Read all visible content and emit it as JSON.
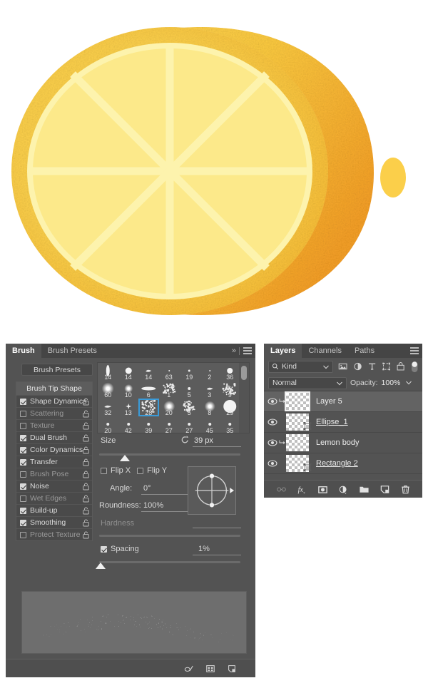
{
  "artwork": {
    "name": "lemon-half-illustration",
    "colors": {
      "rind_outer": "#f5a623",
      "rind_mid": "#f9c33c",
      "body_back": "#fbcf4a",
      "flesh": "#fce98a",
      "flesh_inner": "#fbe071",
      "segment_line": "#fdf3ad",
      "nub": "#fbcf4a",
      "background": "#ffffff"
    }
  },
  "brush_panel": {
    "tabs": [
      {
        "label": "Brush",
        "active": true
      },
      {
        "label": "Brush Presets",
        "active": false
      }
    ],
    "header_icons": [
      {
        "name": "collapse-chevrons-icon",
        "glyph": "»"
      },
      {
        "name": "panel-menu-icon",
        "glyph": "☰"
      }
    ],
    "presets_button": "Brush Presets",
    "options": [
      {
        "label": "Brush Tip Shape",
        "header": true
      },
      {
        "label": "Shape Dynamics",
        "checked": true,
        "dim": false
      },
      {
        "label": "Scattering",
        "checked": false,
        "dim": true
      },
      {
        "label": "Texture",
        "checked": false,
        "dim": true
      },
      {
        "label": "Dual Brush",
        "checked": true,
        "dim": false
      },
      {
        "label": "Color Dynamics",
        "checked": true,
        "dim": false
      },
      {
        "label": "Transfer",
        "checked": true,
        "dim": false
      },
      {
        "label": "Brush Pose",
        "checked": false,
        "dim": true
      },
      {
        "label": "Noise",
        "checked": true,
        "dim": false
      },
      {
        "label": "Wet Edges",
        "checked": false,
        "dim": true
      },
      {
        "label": "Build-up",
        "checked": true,
        "dim": false
      },
      {
        "label": "Smoothing",
        "checked": true,
        "dim": false
      },
      {
        "label": "Protect Texture",
        "checked": false,
        "dim": true
      }
    ],
    "brush_grid": {
      "rows": [
        [
          {
            "size": "14",
            "shape": "vertical-ellipse",
            "w": 5,
            "h": 16
          },
          {
            "size": "14",
            "shape": "round",
            "w": 9,
            "h": 9
          },
          {
            "size": "14",
            "shape": "smear",
            "w": 8,
            "h": 4
          },
          {
            "size": "63",
            "shape": "tiny",
            "w": 2,
            "h": 2
          },
          {
            "size": "19",
            "shape": "tiny",
            "w": 3,
            "h": 3
          },
          {
            "size": "2",
            "shape": "tiny",
            "w": 2,
            "h": 2
          },
          {
            "size": "36",
            "shape": "round",
            "w": 8,
            "h": 8
          }
        ],
        [
          {
            "size": "60",
            "shape": "soft",
            "w": 17,
            "h": 17
          },
          {
            "size": "10",
            "shape": "soft",
            "w": 12,
            "h": 12
          },
          {
            "size": "6",
            "shape": "flat",
            "w": 20,
            "h": 5
          },
          {
            "size": "1",
            "shape": "scatter",
            "w": 16,
            "h": 12
          },
          {
            "size": "5",
            "shape": "tiny",
            "w": 4,
            "h": 4
          },
          {
            "size": "3",
            "shape": "smear",
            "w": 9,
            "h": 4
          },
          {
            "size": "9",
            "shape": "noise",
            "w": 19,
            "h": 17
          }
        ],
        [
          {
            "size": "32",
            "shape": "smear",
            "w": 10,
            "h": 4
          },
          {
            "size": "13",
            "shape": "star",
            "w": 8,
            "h": 8
          },
          {
            "size": "28",
            "shape": "scatter",
            "w": 18,
            "h": 16,
            "selected": true
          },
          {
            "size": "20",
            "shape": "soft",
            "w": 16,
            "h": 16
          },
          {
            "size": "5",
            "shape": "scatter",
            "w": 15,
            "h": 14
          },
          {
            "size": "8",
            "shape": "soft",
            "w": 15,
            "h": 15
          },
          {
            "size": "29",
            "shape": "round",
            "w": 18,
            "h": 18
          }
        ],
        [
          {
            "size": "20",
            "shape": "tiny",
            "w": 4,
            "h": 4
          },
          {
            "size": "42",
            "shape": "tiny",
            "w": 4,
            "h": 4
          },
          {
            "size": "39",
            "shape": "tiny",
            "w": 4,
            "h": 4
          },
          {
            "size": "27",
            "shape": "tiny",
            "w": 4,
            "h": 4
          },
          {
            "size": "27",
            "shape": "tiny",
            "w": 4,
            "h": 4
          },
          {
            "size": "45",
            "shape": "tiny",
            "w": 4,
            "h": 4
          },
          {
            "size": "35",
            "shape": "tiny",
            "w": 4,
            "h": 4
          }
        ]
      ],
      "selected_size": "39"
    },
    "controls": {
      "size_label": "Size",
      "size_value": "39 px",
      "reset_icon": "reset-arrow-icon",
      "flip_x": "Flip X",
      "flip_y": "Flip Y",
      "flip_x_checked": false,
      "flip_y_checked": false,
      "angle_label": "Angle:",
      "angle_value": "0°",
      "roundness_label": "Roundness:",
      "roundness_value": "100%",
      "hardness_label": "Hardness",
      "spacing_label": "Spacing",
      "spacing_checked": true,
      "spacing_value": "1%"
    },
    "footer_icons": [
      {
        "name": "toggle-airbrush-icon"
      },
      {
        "name": "brush-panel-grid-icon"
      },
      {
        "name": "new-brush-preset-icon"
      }
    ]
  },
  "layers_panel": {
    "tabs": [
      {
        "label": "Layers",
        "active": true
      },
      {
        "label": "Channels",
        "active": false
      },
      {
        "label": "Paths",
        "active": false
      }
    ],
    "header_icons": [
      {
        "name": "panel-menu-icon",
        "glyph": "☰"
      }
    ],
    "filter": {
      "kind_label": "Kind",
      "search_icon": "search-icon",
      "icons": [
        {
          "name": "filter-pixel-icon"
        },
        {
          "name": "filter-adjustment-icon"
        },
        {
          "name": "filter-type-icon"
        },
        {
          "name": "filter-shape-icon"
        },
        {
          "name": "filter-smart-object-icon"
        }
      ],
      "toggle_name": "filter-enable-toggle"
    },
    "blend": {
      "mode": "Normal",
      "opacity_label": "Opacity:",
      "opacity_value": "100%"
    },
    "layers": [
      {
        "name": "Layer 5",
        "visible": true,
        "selected": true,
        "clipped": true,
        "underlined": false,
        "thumb_selected": true,
        "vector": false
      },
      {
        "name": "Ellipse_1",
        "visible": true,
        "selected": false,
        "clipped": false,
        "underlined": true,
        "thumb_selected": false,
        "vector": true
      },
      {
        "name": "Lemon body",
        "visible": true,
        "selected": false,
        "clipped": true,
        "underlined": false,
        "thumb_selected": false,
        "vector": false
      },
      {
        "name": "Rectangle 2",
        "visible": true,
        "selected": false,
        "clipped": false,
        "underlined": true,
        "thumb_selected": false,
        "vector": true
      }
    ],
    "footer_icons": [
      {
        "name": "link-layers-icon"
      },
      {
        "name": "layer-style-fx-icon"
      },
      {
        "name": "add-layer-mask-icon"
      },
      {
        "name": "new-adjustment-layer-icon"
      },
      {
        "name": "new-group-icon"
      },
      {
        "name": "new-layer-icon"
      },
      {
        "name": "delete-layer-icon"
      }
    ]
  }
}
